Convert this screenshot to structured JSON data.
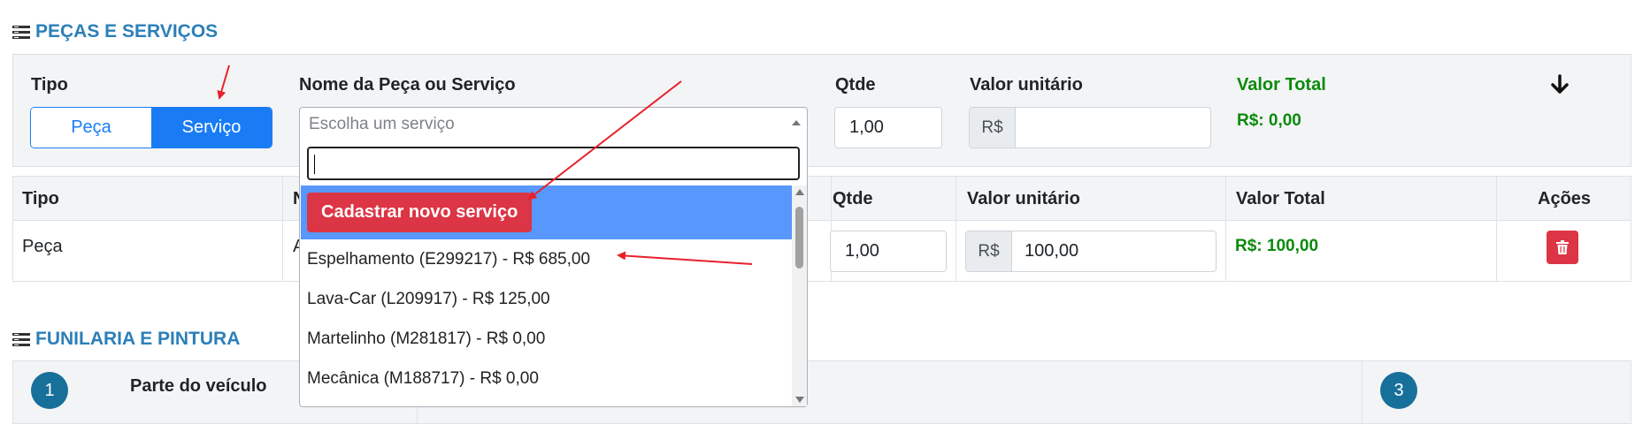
{
  "sections": {
    "parts_services": "PEÇAS E SERVIÇOS",
    "bodywork": "FUNILARIA E PINTURA"
  },
  "form": {
    "tipo_label": "Tipo",
    "tipo_options": [
      "Peça",
      "Serviço"
    ],
    "tipo_selected": "Serviço",
    "name_label": "Nome da Peça ou Serviço",
    "name_placeholder": "Escolha um serviço",
    "qtde_label": "Qtde",
    "qtde_value": "1,00",
    "unit_label": "Valor unitário",
    "currency_prefix": "R$",
    "unit_value": "",
    "total_label": "Valor Total",
    "total_value": "R$: 0,00"
  },
  "table": {
    "headers": [
      "Tipo",
      "N",
      "Qtde",
      "Valor unitário",
      "Valor Total",
      "Ações"
    ],
    "rows": [
      {
        "tipo": "Peça",
        "nome": "A",
        "qtde": "1,00",
        "currency": "R$",
        "valor": "100,00",
        "total": "R$: 100,00"
      }
    ]
  },
  "dropdown": {
    "search_value": "",
    "new_button": "Cadastrar novo serviço",
    "options": [
      "Espelhamento (E299217) - R$ 685,00",
      "Lava-Car (L209917) - R$ 125,00",
      "Martelinho (M281817) - R$ 0,00",
      "Mecânica (M188717) - R$ 0,00"
    ]
  },
  "bodywork": {
    "steps": [
      "1",
      "3"
    ],
    "part_label": "Parte do veículo"
  },
  "colors": {
    "primary": "#1a7cf5",
    "danger": "#dc3545",
    "success": "#0a8a0a",
    "section_title": "#2c7fb8",
    "highlight": "#5897fb",
    "annotation_arrow": "#e8212b"
  }
}
